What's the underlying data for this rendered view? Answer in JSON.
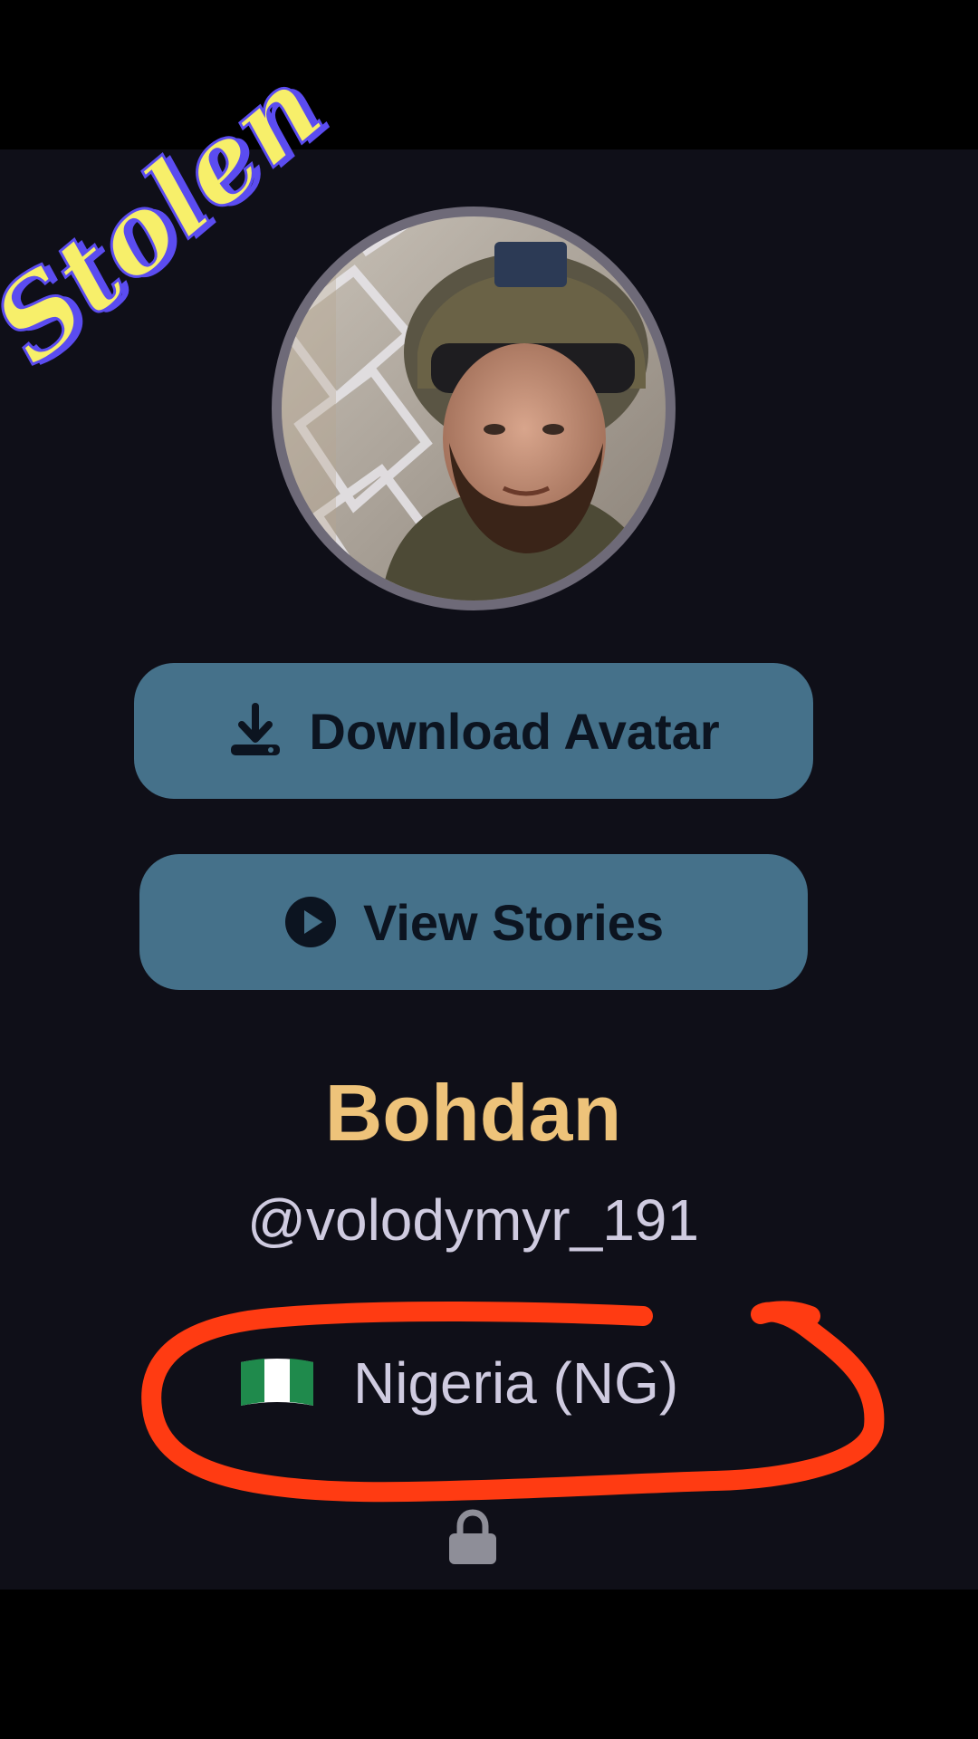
{
  "overlay": {
    "stamp_text": "Stolen",
    "stamp_fill": "#f7ef6a",
    "stamp_shadow": "#5b4cf0",
    "scribble_color": "#ff3b12"
  },
  "profile": {
    "avatar_icon": "profile-photo",
    "display_name": "Bohdan",
    "username": "@volodymyr_191",
    "country_flag_icon": "nigeria-flag-icon",
    "country": "Nigeria (NG)",
    "lock_icon": "lock-icon"
  },
  "actions": {
    "download_label": "Download Avatar",
    "download_icon": "download-icon",
    "stories_label": "View Stories",
    "stories_icon": "play-circle-icon"
  },
  "colors": {
    "background": "#0f0f18",
    "button": "#45718a",
    "name": "#eec37a",
    "text": "#cfcbe0"
  }
}
